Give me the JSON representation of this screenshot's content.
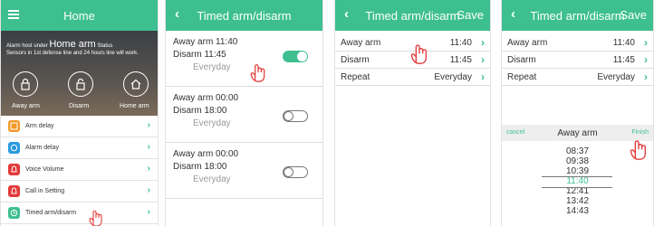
{
  "colors": {
    "accent": "#3dbf90",
    "arm": "#f39a2a",
    "alarm": "#2a9ae0",
    "red": "#e33a3a",
    "green_icon": "#3dbf90"
  },
  "panel1": {
    "title": "Home",
    "hero": {
      "status_prefix": "Alarm host under",
      "status_big": "Home arm",
      "status_suffix": "Status",
      "note": "Sensors in 1st defense line and 24 hours line will work.",
      "buttons": [
        {
          "label": "Away arm",
          "icon": "lock-icon"
        },
        {
          "label": "Disarm",
          "icon": "unlock-icon"
        },
        {
          "label": "Home arm",
          "icon": "home-icon"
        }
      ]
    },
    "menu": [
      {
        "label": "Arm delay",
        "icon": "arm-delay-icon"
      },
      {
        "label": "Alarm delay",
        "icon": "alarm-delay-icon"
      },
      {
        "label": "Voice Volume",
        "icon": "bell-icon"
      },
      {
        "label": "Call in Setting",
        "icon": "phone-icon"
      },
      {
        "label": "Timed arm/disarm",
        "icon": "clock-icon"
      }
    ]
  },
  "panel2": {
    "title": "Timed arm/disarm",
    "items": [
      {
        "arm": "Away arm 11:40",
        "disarm": "Disarm  11:45",
        "repeat": "Everyday",
        "enabled": true
      },
      {
        "arm": "Away arm 00:00",
        "disarm": "Disarm  18:00",
        "repeat": "Everyday",
        "enabled": false
      },
      {
        "arm": "Away arm  00:00",
        "disarm": "Disarm  18:00",
        "repeat": "Everyday",
        "enabled": false
      }
    ]
  },
  "panel3": {
    "title": "Timed arm/disarm",
    "save": "Save",
    "rows": [
      {
        "label": "Away arm",
        "value": "11:40"
      },
      {
        "label": "Disarm",
        "value": "11:45"
      },
      {
        "label": "Repeat",
        "value": "Everyday"
      }
    ]
  },
  "panel4": {
    "title": "Timed arm/disarm",
    "save": "Save",
    "rows": [
      {
        "label": "Away arm",
        "value": "11:40"
      },
      {
        "label": "Disarm",
        "value": "11:45"
      },
      {
        "label": "Repeat",
        "value": "Everyday"
      }
    ],
    "picker": {
      "cancel": "cancel",
      "title": "Away arm",
      "finish": "Finish",
      "times": [
        "08:37",
        "09:38",
        "10:39",
        "11:40",
        "12:41",
        "13:42",
        "14:43"
      ],
      "selected_index": 3
    }
  }
}
